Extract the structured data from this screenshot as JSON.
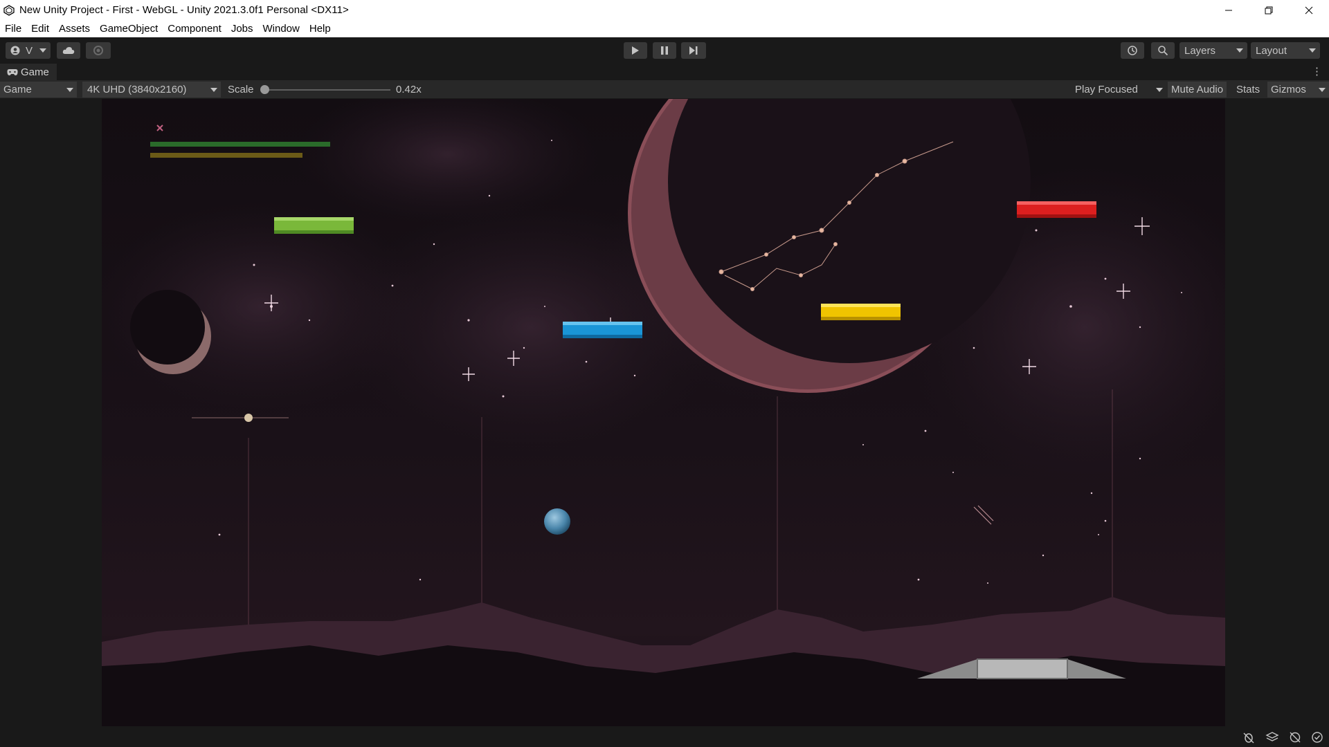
{
  "window": {
    "title": "New Unity Project - First - WebGL - Unity 2021.3.0f1 Personal <DX11>"
  },
  "menu": [
    "File",
    "Edit",
    "Assets",
    "GameObject",
    "Component",
    "Jobs",
    "Window",
    "Help"
  ],
  "toolbar": {
    "account_label": "V",
    "layers_label": "Layers",
    "layout_label": "Layout"
  },
  "tab": {
    "label": "Game"
  },
  "game_bar": {
    "display": "Game",
    "resolution": "4K UHD (3840x2160)",
    "scale_label": "Scale",
    "scale_value": "0.42x",
    "scale_fraction": 0.0,
    "play_mode": "Play Focused",
    "mute": "Mute Audio",
    "stats": "Stats",
    "gizmos": "Gizmos"
  },
  "game": {
    "bricks": [
      {
        "name": "green",
        "color": "#7ab83a"
      },
      {
        "name": "blue",
        "color": "#1a95d6"
      },
      {
        "name": "yellow",
        "color": "#f0c400"
      },
      {
        "name": "red",
        "color": "#dc1f1f"
      }
    ],
    "hud_bars": [
      {
        "name": "health",
        "color": "#2a6b2a"
      },
      {
        "name": "energy",
        "color": "#6b5a17"
      }
    ]
  },
  "icons": {
    "play": "play-icon",
    "pause": "pause-icon",
    "step": "step-icon",
    "history": "history-icon",
    "search": "search-icon",
    "cloud": "cloud-icon",
    "collab": "collab-icon"
  }
}
